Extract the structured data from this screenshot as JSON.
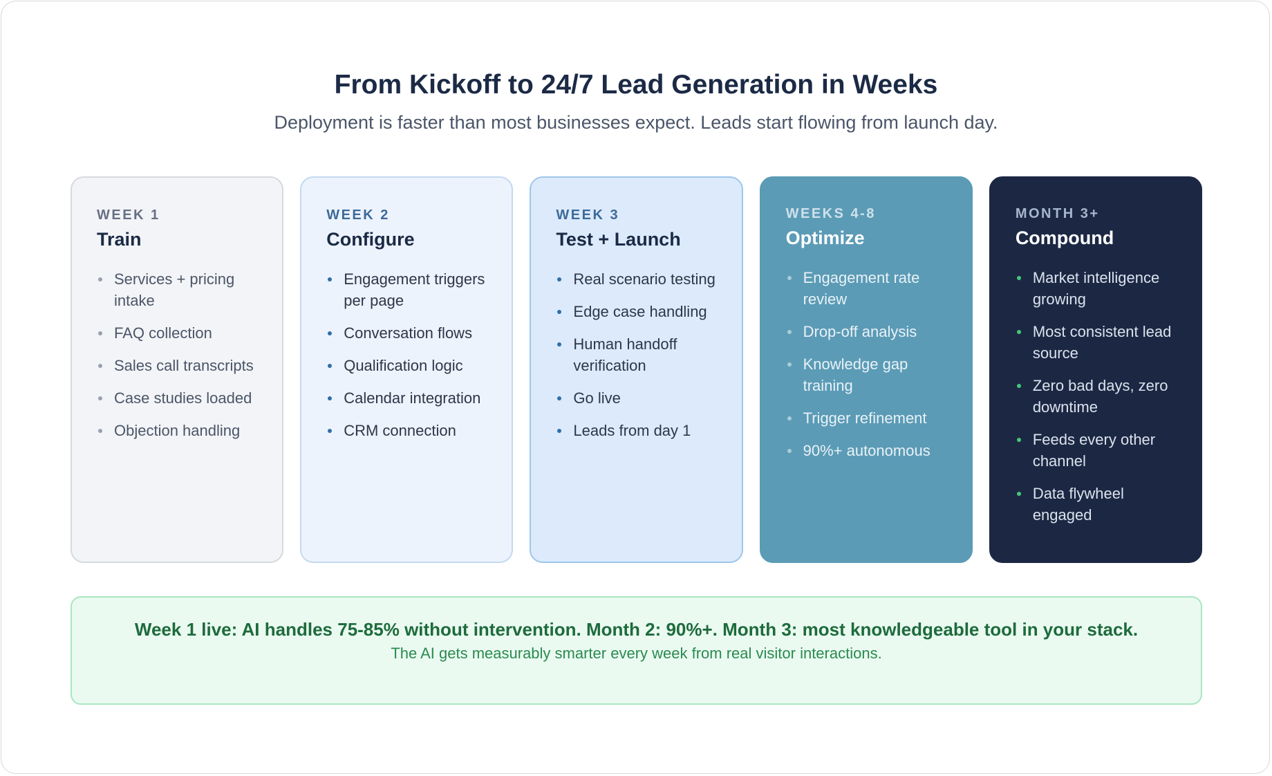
{
  "header": {
    "title": "From Kickoff to 24/7 Lead Generation in Weeks",
    "subtitle": "Deployment is faster than most businesses expect. Leads start flowing from launch day."
  },
  "phases": [
    {
      "tag": "WEEK 1",
      "name": "Train",
      "items": [
        "Services + pricing intake",
        "FAQ collection",
        "Sales call transcripts",
        "Case studies loaded",
        "Objection handling"
      ]
    },
    {
      "tag": "WEEK 2",
      "name": "Configure",
      "items": [
        "Engagement triggers per page",
        "Conversation flows",
        "Qualification logic",
        "Calendar integration",
        "CRM connection"
      ]
    },
    {
      "tag": "WEEK 3",
      "name": "Test + Launch",
      "items": [
        "Real scenario testing",
        "Edge case handling",
        "Human handoff verification",
        "Go live",
        "Leads from day 1"
      ]
    },
    {
      "tag": "WEEKS 4-8",
      "name": "Optimize",
      "items": [
        "Engagement rate review",
        "Drop-off analysis",
        "Knowledge gap training",
        "Trigger refinement",
        "90%+ autonomous"
      ]
    },
    {
      "tag": "MONTH 3+",
      "name": "Compound",
      "items": [
        "Market intelligence growing",
        "Most consistent lead source",
        "Zero bad days, zero downtime",
        "Feeds every other channel",
        "Data flywheel engaged"
      ]
    }
  ],
  "callout": {
    "headline": "Week 1 live: AI handles 75-85% without intervention. Month 2: 90%+. Month 3: most knowledgeable tool in your stack.",
    "subtext": "The AI gets measurably smarter every week from real visitor interactions."
  },
  "colors": {
    "title": "#1b2a45",
    "week1_bg": "#f3f4f7",
    "week2_bg": "#edf3fd",
    "week3_bg": "#dceafb",
    "weeks4_8_bg": "#5b9bb6",
    "month3_bg": "#1c2843",
    "callout_bg": "#eafaf1",
    "callout_text": "#1e6b3c"
  }
}
